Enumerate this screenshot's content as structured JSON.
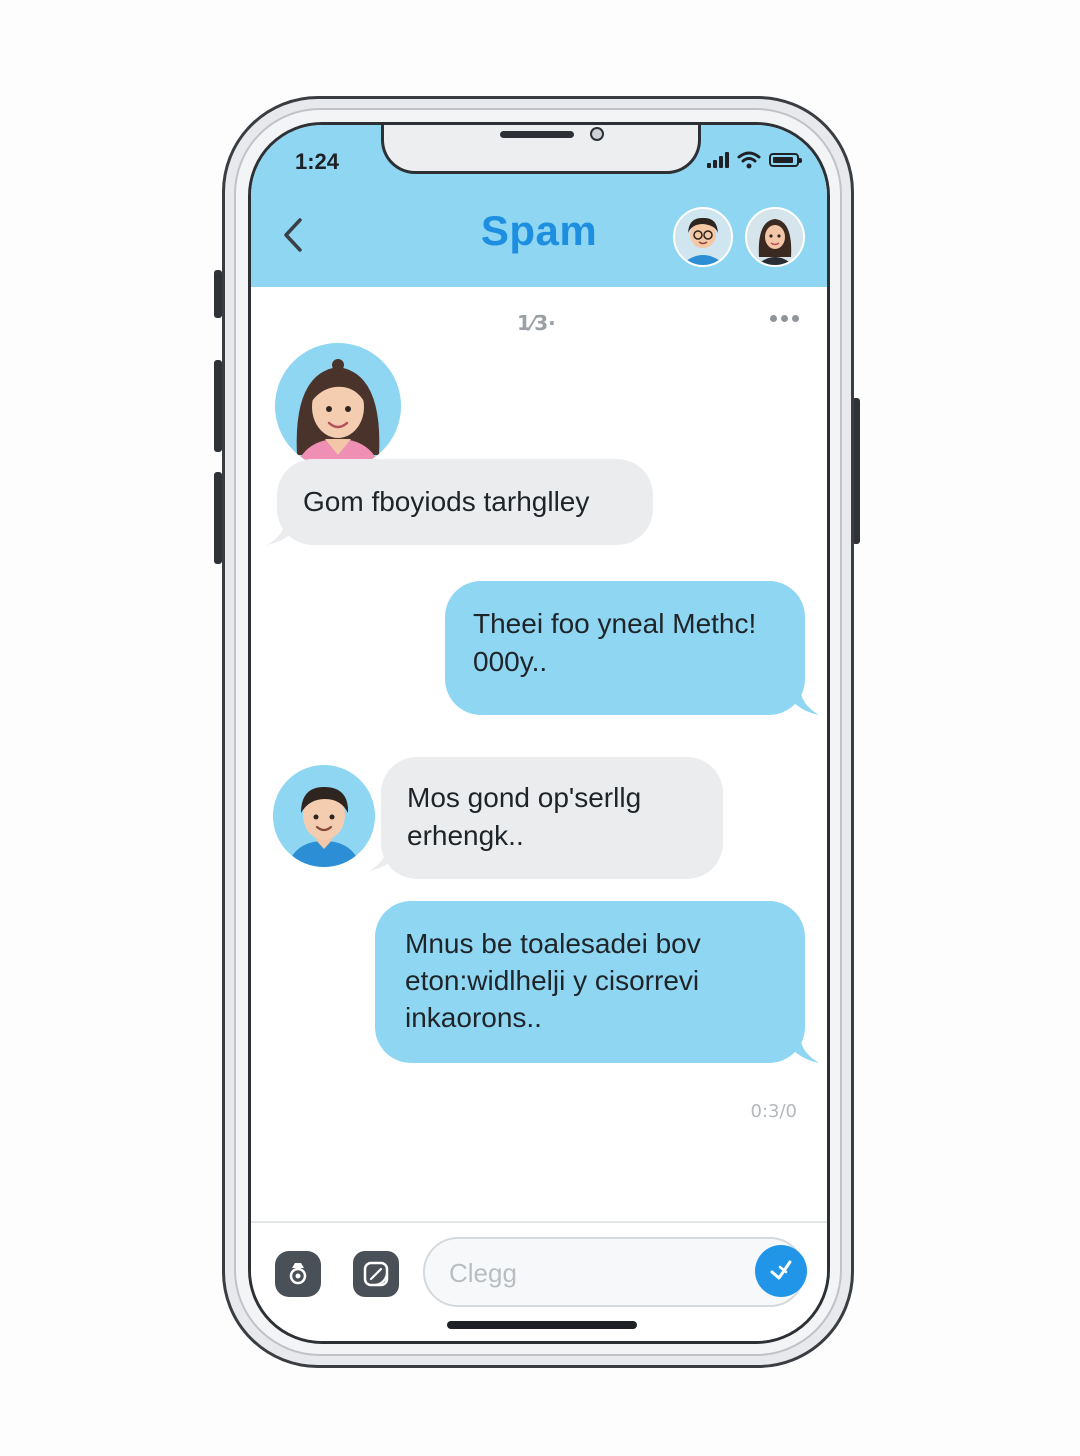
{
  "status_bar": {
    "time": "1:24",
    "icons": [
      "cellular-signal-icon",
      "wifi-icon",
      "battery-icon"
    ]
  },
  "header": {
    "back_icon": "chevron-left-icon",
    "title": "Spam",
    "participants": [
      "avatar-man",
      "avatar-woman"
    ]
  },
  "conversation": {
    "meta_label": "1⁄3·",
    "more_icon": "more-dots-icon",
    "messages": [
      {
        "direction": "incoming",
        "sender": "avatar-woman-pink",
        "text": "Gom fboyiods tarhglley"
      },
      {
        "direction": "outgoing",
        "text_line1": "Theei foo yneal Methc!",
        "text_line2": "000y.."
      },
      {
        "direction": "incoming",
        "sender": "avatar-man-blue",
        "text_line1": "Mos gond op'serllg",
        "text_line2": "erhengk.."
      },
      {
        "direction": "outgoing",
        "text_line1": "Mnus be toalesadei bov",
        "text_line2": "eton:widlhelji y cisorrevi",
        "text_line3": "inkaorons.."
      }
    ],
    "timestamp": "0:3/0"
  },
  "input_bar": {
    "camera_icon": "camera-icon",
    "sticker_icon": "sticker-icon",
    "placeholder": "Clegg",
    "send_icon": "send-icon"
  },
  "colors": {
    "header_bg": "#8fd6f3",
    "title": "#1e8fe0",
    "incoming_bubble": "#ebecee",
    "outgoing_bubble": "#8fd6f3",
    "send_button": "#2196e8"
  }
}
